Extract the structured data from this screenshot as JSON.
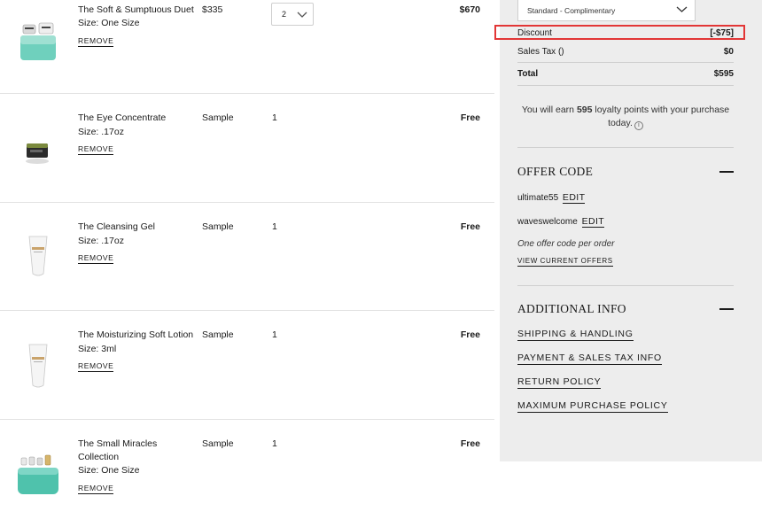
{
  "cart": {
    "items": [
      {
        "name": "The Soft & Sumptuous Duet",
        "size": "Size: One Size",
        "price": "$335",
        "qty": "2",
        "total": "$670",
        "remove": "REMOVE",
        "icon": "jar-duet-icon"
      },
      {
        "name": "The Eye Concentrate",
        "size": "Size: .17oz",
        "price": "Sample",
        "qty": "1",
        "total": "Free",
        "remove": "REMOVE",
        "icon": "jar-icon"
      },
      {
        "name": "The Cleansing Gel",
        "size": "Size: .17oz",
        "price": "Sample",
        "qty": "1",
        "total": "Free",
        "remove": "REMOVE",
        "icon": "tube-icon"
      },
      {
        "name": "The Moisturizing Soft Lotion",
        "size": "Size: 3ml",
        "price": "Sample",
        "qty": "1",
        "total": "Free",
        "remove": "REMOVE",
        "icon": "tube-icon"
      },
      {
        "name": "The Small Miracles Collection",
        "size": "Size: One Size",
        "price": "Sample",
        "qty": "1",
        "total": "Free",
        "remove": "REMOVE",
        "icon": "collection-bag-icon"
      }
    ]
  },
  "summary": {
    "shipping_option": "Standard - Complimentary",
    "discount_label": "Discount",
    "discount_value": "[-$75]",
    "tax_label": "Sales Tax ()",
    "tax_value": "$0",
    "total_label": "Total",
    "total_value": "$595",
    "loyalty_prefix": "You will earn ",
    "loyalty_points": "595",
    "loyalty_suffix": " loyalty points with your purchase today.",
    "offer_title": "OFFER CODE",
    "codes": [
      {
        "code": "ultimate55",
        "edit": "EDIT"
      },
      {
        "code": "waveswelcome",
        "edit": "EDIT"
      }
    ],
    "offer_note": "One offer code per order",
    "view_offers": "VIEW CURRENT OFFERS",
    "additional_title": "ADDITIONAL INFO",
    "links": [
      "SHIPPING & HANDLING",
      "PAYMENT & SALES TAX INFO",
      "RETURN POLICY",
      "MAXIMUM PURCHASE POLICY"
    ]
  },
  "colors": {
    "panel": "#ededed",
    "highlight": "#e23636",
    "teal": "#5cc9b4"
  }
}
